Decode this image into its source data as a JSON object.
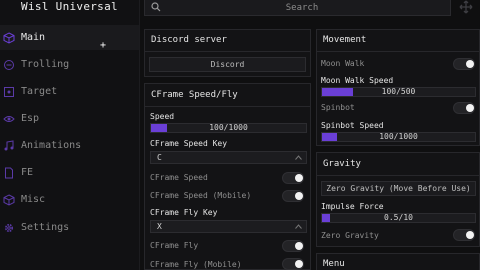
{
  "app": {
    "title": "Wisl Universal"
  },
  "search": {
    "placeholder": "Search"
  },
  "sidebar": {
    "items": [
      {
        "label": "Main",
        "icon": "cube-icon",
        "active": true
      },
      {
        "label": "Trolling",
        "icon": "circle-icon"
      },
      {
        "label": "Target",
        "icon": "target-icon"
      },
      {
        "label": "Esp",
        "icon": "eye-icon"
      },
      {
        "label": "Animations",
        "icon": "music-icon"
      },
      {
        "label": "FE",
        "icon": "file-icon"
      },
      {
        "label": "Misc",
        "icon": "cube-icon"
      },
      {
        "label": "Settings",
        "icon": "gear-icon"
      }
    ]
  },
  "discord": {
    "title": "Discord server",
    "button": "Discord"
  },
  "cframe": {
    "title": "CFrame Speed/Fly",
    "speed_label": "Speed",
    "speed_value": "100/1000",
    "speed_fraction": 0.1,
    "speed_key_label": "CFrame Speed Key",
    "speed_key_value": "C",
    "cframe_speed": "CFrame Speed",
    "cframe_speed_mobile": "CFrame Speed (Mobile)",
    "fly_key_label": "CFrame Fly Key",
    "fly_key_value": "X",
    "cframe_fly": "CFrame Fly",
    "cframe_fly_mobile": "CFrame Fly (Mobile)"
  },
  "movement": {
    "title": "Movement",
    "moon_walk": "Moon Walk",
    "moon_walk_speed_label": "Moon Walk Speed",
    "moon_walk_speed_value": "100/500",
    "moon_walk_speed_fraction": 0.2,
    "spinbot": "Spinbot",
    "spinbot_speed_label": "Spinbot Speed",
    "spinbot_speed_value": "100/1000",
    "spinbot_speed_fraction": 0.1
  },
  "gravity": {
    "title": "Gravity",
    "button": "Zero Gravity (Move Before Use)",
    "impulse_label": "Impulse Force",
    "impulse_value": "0.5/10",
    "impulse_fraction": 0.05,
    "zero_gravity": "Zero Gravity"
  },
  "menu": {
    "title": "Menu"
  },
  "colors": {
    "accent": "#6a3fd6",
    "background": "#0f0f10",
    "panel": "#131315"
  }
}
